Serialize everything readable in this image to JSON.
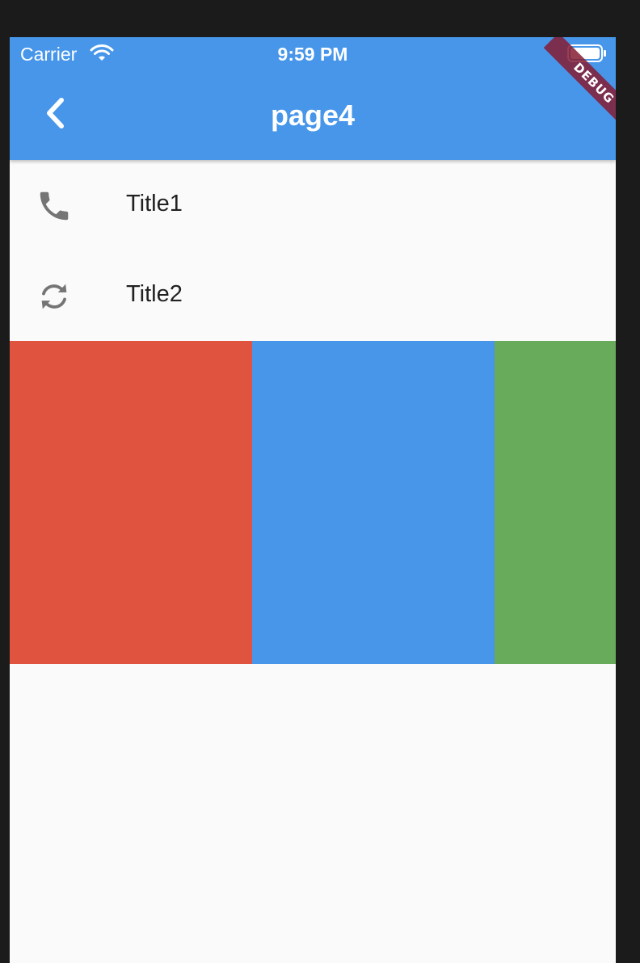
{
  "status_bar": {
    "carrier": "Carrier",
    "time": "9:59 PM",
    "wifi_icon": "wifi-icon",
    "battery_icon": "battery-icon"
  },
  "app_bar": {
    "title": "page4",
    "back_icon": "chevron-left-icon",
    "background_color": "#4796ea"
  },
  "list": {
    "items": [
      {
        "icon": "phone-icon",
        "title": "Title1"
      },
      {
        "icon": "sync-icon",
        "title": "Title2"
      }
    ]
  },
  "color_blocks": [
    {
      "name": "red",
      "color": "#e0533f"
    },
    {
      "name": "blue",
      "color": "#4796ea"
    },
    {
      "name": "green",
      "color": "#67ab5b"
    }
  ],
  "debug_banner": {
    "label": "DEBUG",
    "color": "#861c32"
  }
}
